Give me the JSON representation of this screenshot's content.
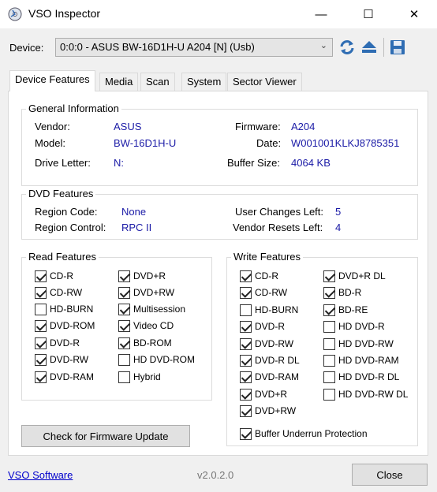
{
  "window": {
    "title": "VSO Inspector",
    "minimize": "—",
    "maximize": "☐",
    "close": "✕"
  },
  "device": {
    "label": "Device:",
    "value": "0:0:0 - ASUS BW-16D1H-U A204 [N] (Usb)"
  },
  "toolbar_icons": [
    "refresh-icon",
    "eject-icon",
    "save-icon"
  ],
  "tabs": [
    "Device Features",
    "Media",
    "Scan",
    "System",
    "Sector Viewer"
  ],
  "general": {
    "title": "General Information",
    "vendor_label": "Vendor:",
    "vendor": "ASUS",
    "model_label": "Model:",
    "model": "BW-16D1H-U",
    "drive_letter_label": "Drive Letter:",
    "drive_letter": "N:",
    "firmware_label": "Firmware:",
    "firmware": "A204",
    "date_label": "Date:",
    "date": "W001001KLKJ8785351",
    "buffer_label": "Buffer Size:",
    "buffer": "4064 KB"
  },
  "dvd": {
    "title": "DVD Features",
    "region_code_label": "Region Code:",
    "region_code": "None",
    "region_control_label": "Region Control:",
    "region_control": "RPC II",
    "user_changes_label": "User Changes Left:",
    "user_changes": "5",
    "vendor_resets_label": "Vendor Resets Left:",
    "vendor_resets": "4"
  },
  "read": {
    "title": "Read Features",
    "col1": [
      {
        "label": "CD-R",
        "checked": true
      },
      {
        "label": "CD-RW",
        "checked": true
      },
      {
        "label": "HD-BURN",
        "checked": false
      },
      {
        "label": "DVD-ROM",
        "checked": true
      },
      {
        "label": "DVD-R",
        "checked": true
      },
      {
        "label": "DVD-RW",
        "checked": true
      },
      {
        "label": "DVD-RAM",
        "checked": true
      }
    ],
    "col2": [
      {
        "label": "DVD+R",
        "checked": true
      },
      {
        "label": "DVD+RW",
        "checked": true
      },
      {
        "label": "Multisession",
        "checked": true
      },
      {
        "label": "Video CD",
        "checked": true
      },
      {
        "label": "BD-ROM",
        "checked": true
      },
      {
        "label": "HD DVD-ROM",
        "checked": false
      },
      {
        "label": "Hybrid",
        "checked": false
      }
    ]
  },
  "write": {
    "title": "Write Features",
    "col1": [
      {
        "label": "CD-R",
        "checked": true
      },
      {
        "label": "CD-RW",
        "checked": true
      },
      {
        "label": "HD-BURN",
        "checked": false
      },
      {
        "label": "DVD-R",
        "checked": true
      },
      {
        "label": "DVD-RW",
        "checked": true
      },
      {
        "label": "DVD-R DL",
        "checked": true
      },
      {
        "label": "DVD-RAM",
        "checked": true
      },
      {
        "label": "DVD+R",
        "checked": true
      },
      {
        "label": "DVD+RW",
        "checked": true
      }
    ],
    "col2": [
      {
        "label": "DVD+R DL",
        "checked": true
      },
      {
        "label": "BD-R",
        "checked": true
      },
      {
        "label": "BD-RE",
        "checked": true
      },
      {
        "label": "HD DVD-R",
        "checked": false
      },
      {
        "label": "HD DVD-RW",
        "checked": false
      },
      {
        "label": "HD DVD-RAM",
        "checked": false
      },
      {
        "label": "HD DVD-R DL",
        "checked": false
      },
      {
        "label": "HD DVD-RW DL",
        "checked": false
      }
    ],
    "buffer_underrun": {
      "label": "Buffer Underrun Protection",
      "checked": true
    }
  },
  "buttons": {
    "firmware_update": "Check for Firmware Update",
    "close": "Close"
  },
  "footer": {
    "link": "VSO Software",
    "version": "v2.0.2.0"
  },
  "colors": {
    "value_text": "#1a1aa6",
    "link": "#0000cc"
  }
}
